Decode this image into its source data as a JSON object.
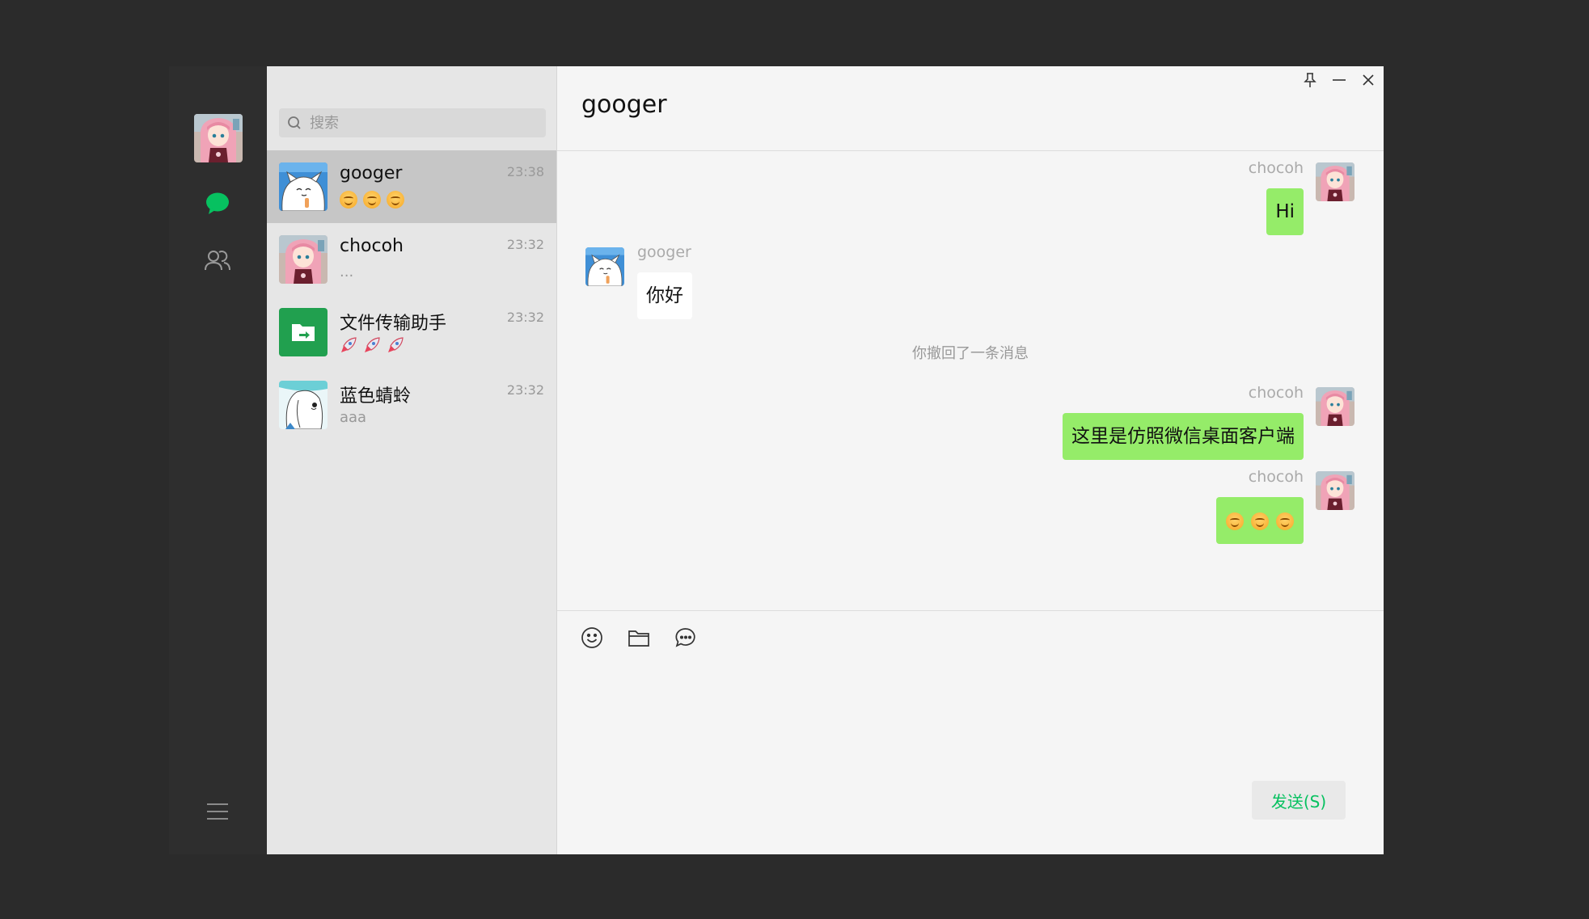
{
  "search": {
    "placeholder": "搜索"
  },
  "conversations": [
    {
      "name": "googer",
      "time": "23:38",
      "preview_type": "emoji-smile",
      "active": true
    },
    {
      "name": "chocoh",
      "time": "23:32",
      "preview": "...",
      "active": false
    },
    {
      "name": "文件传输助手",
      "time": "23:32",
      "preview_type": "rocket",
      "active": false
    },
    {
      "name": "蓝色蜻蛉",
      "time": "23:32",
      "preview": "aaa",
      "active": false
    }
  ],
  "chat": {
    "title": "googer",
    "messages": [
      {
        "sender": "chocoh",
        "from_me": true,
        "text": "Hi"
      },
      {
        "sender": "googer",
        "from_me": false,
        "text": "你好"
      },
      {
        "system": "你撤回了一条消息"
      },
      {
        "sender": "chocoh",
        "from_me": true,
        "text": "这里是仿照微信桌面客户端"
      },
      {
        "sender": "chocoh",
        "from_me": true,
        "content_type": "emoji-smile"
      }
    ],
    "send_label": "发送(S)"
  },
  "colors": {
    "accent_green": "#07c160",
    "my_bubble": "#95ec69",
    "other_bubble": "#ffffff",
    "nav_bg": "#2e2e2e",
    "list_bg": "#e6e6e6",
    "active_row": "#c6c6c6",
    "chat_bg": "#f5f5f5"
  },
  "icons": {
    "nav": [
      "chat-bubble-icon",
      "contacts-icon",
      "menu-icon"
    ],
    "window": [
      "pin-icon",
      "minimize-icon",
      "close-icon"
    ],
    "toolbar": [
      "emoji-icon",
      "folder-icon",
      "chat-history-icon"
    ]
  }
}
